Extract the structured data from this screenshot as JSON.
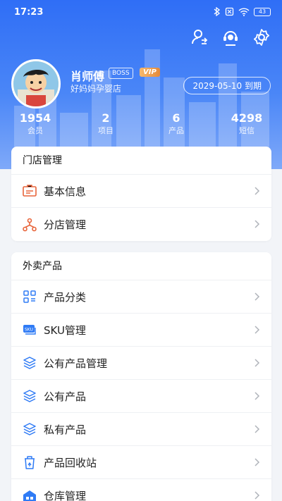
{
  "status_bar": {
    "time": "17:23",
    "battery": "43"
  },
  "colors": {
    "header": "#2f6ef6",
    "accent_orange": "#e8643a",
    "accent_blue": "#2f7bf5"
  },
  "profile": {
    "name": "肖师傅",
    "role_badge": "BOSS",
    "vip_badge": "VIP",
    "store": "好妈妈孕婴店",
    "expire": "2029-05-10 到期"
  },
  "stats": [
    {
      "value": "1954",
      "label": "会员"
    },
    {
      "value": "2",
      "label": "项目"
    },
    {
      "value": "6",
      "label": "产品"
    },
    {
      "value": "4298",
      "label": "短信"
    }
  ],
  "store_mgmt": {
    "title": "门店管理",
    "items": [
      {
        "label": "基本信息",
        "icon": "id-card-icon"
      },
      {
        "label": "分店管理",
        "icon": "branch-icon"
      }
    ]
  },
  "takeout": {
    "title": "外卖产品",
    "items": [
      {
        "label": "产品分类",
        "icon": "category-icon"
      },
      {
        "label": "SKU管理",
        "icon": "sku-icon"
      },
      {
        "label": "公有产品管理",
        "icon": "layers-icon"
      },
      {
        "label": "公有产品",
        "icon": "layers-icon"
      },
      {
        "label": "私有产品",
        "icon": "layers-icon"
      },
      {
        "label": "产品回收站",
        "icon": "recycle-icon"
      },
      {
        "label": "仓库管理",
        "icon": "warehouse-icon"
      }
    ]
  }
}
